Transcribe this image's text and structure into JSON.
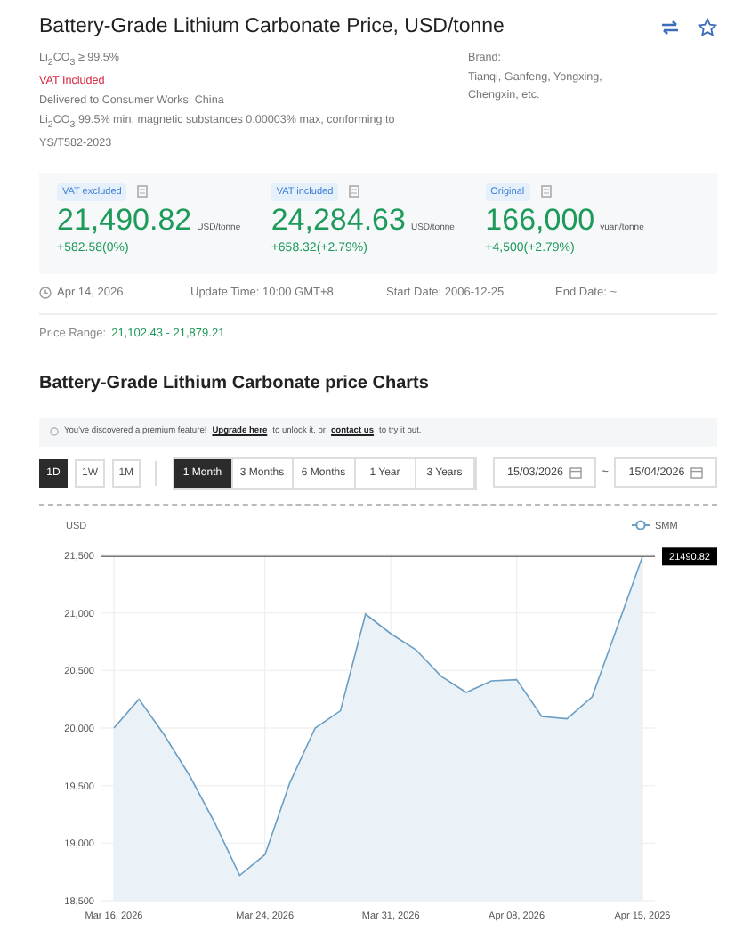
{
  "header": {
    "title": "Battery-Grade Lithium Carbonate Price, USD/tonne",
    "actions": [
      {
        "kind": "swap"
      },
      {
        "kind": "star",
        "selected": false
      }
    ]
  },
  "spec": {
    "lines": [
      {
        "text": "Li$_{2}$CO$_{3}$ ≥ 99.5%",
        "kind": "plain"
      },
      {
        "text": "VAT Included",
        "kind": "alert"
      },
      {
        "text": "Delivered to Consumer Works, China",
        "kind": "plain"
      },
      {
        "text": "Li$_{2}$CO$_{3}$ 99.5% min, magnetic substances 0.00003% max, conforming to YS/T582-2023",
        "kind": "plain"
      }
    ],
    "brand_label": "Brand:",
    "brand_value": "Tianqi, Ganfeng, Yongxing, Chengxin, etc."
  },
  "prices": [
    {
      "badge": "VAT excluded",
      "value": "21,490.82",
      "unit": "USD/tonne",
      "change": "+582.58(0%)"
    },
    {
      "badge": "VAT included",
      "value": "24,284.63",
      "unit": "USD/tonne",
      "change": "+658.32(+2.79%)"
    },
    {
      "badge": "Original",
      "value": "166,000",
      "unit": "yuan/tonne",
      "change": "+4,500(+2.79%)"
    }
  ],
  "info": {
    "date": "Apr 14, 2026",
    "update_time": "Update Time: 10:00 GMT+8",
    "start_date": "Start Date: 2006-12-25",
    "end_date": "End Date: ~"
  },
  "price_range": {
    "label": "Price Range:",
    "value": "21,102.43 - 21,879.21"
  },
  "charts_title": "Battery-Grade Lithium Carbonate price Charts",
  "notice": {
    "before": "You've discovered a premium feature!",
    "link1": "Upgrade here",
    "middle": "to unlock it, or",
    "link2": "contact us",
    "after": "to try it out."
  },
  "granularity": [
    {
      "label": "1D",
      "selected": true
    },
    {
      "label": "1W",
      "selected": false
    },
    {
      "label": "1M",
      "selected": false
    }
  ],
  "ranges": [
    {
      "label": "1 Month",
      "selected": true
    },
    {
      "label": "3 Months",
      "selected": false
    },
    {
      "label": "6 Months",
      "selected": false
    },
    {
      "label": "1 Year",
      "selected": false
    },
    {
      "label": "3 Years",
      "selected": false
    }
  ],
  "date_from": "15/03/2026",
  "date_separator": "~",
  "date_to": "15/04/2026",
  "chart": {
    "chart_data": {
      "type": "area",
      "ylabel": "USD",
      "grid": true,
      "categories": [
        "Mar 16, 2026",
        null,
        null,
        null,
        null,
        null,
        "Mar 24, 2026",
        null,
        null,
        null,
        null,
        "Mar 31, 2026",
        null,
        null,
        null,
        null,
        "Apr 08, 2026",
        null,
        null,
        null,
        null,
        "Apr 15, 2026"
      ],
      "series": [
        {
          "name": "SMM",
          "color": "#6a9ec4",
          "values": [
            20000,
            20250,
            19940,
            19590,
            19180,
            18720,
            18900,
            19530,
            20000,
            20150,
            20990,
            20820,
            20680,
            20450,
            20310,
            20410,
            20420,
            20100,
            20080,
            20270,
            20880,
            21490
          ]
        }
      ],
      "ylim": [
        18500,
        21500
      ],
      "yticks": [
        {
          "value": 18500,
          "label": "18,500"
        },
        {
          "value": 19000,
          "label": "19,000"
        },
        {
          "value": 19500,
          "label": "19,500"
        },
        {
          "value": 20000,
          "label": "20,000"
        },
        {
          "value": 20500,
          "label": "20,500"
        },
        {
          "value": 21000,
          "label": "21,000"
        },
        {
          "value": 21500,
          "label": "21,500"
        }
      ],
      "xlabel": null
    },
    "tooltip": "21490.82"
  }
}
